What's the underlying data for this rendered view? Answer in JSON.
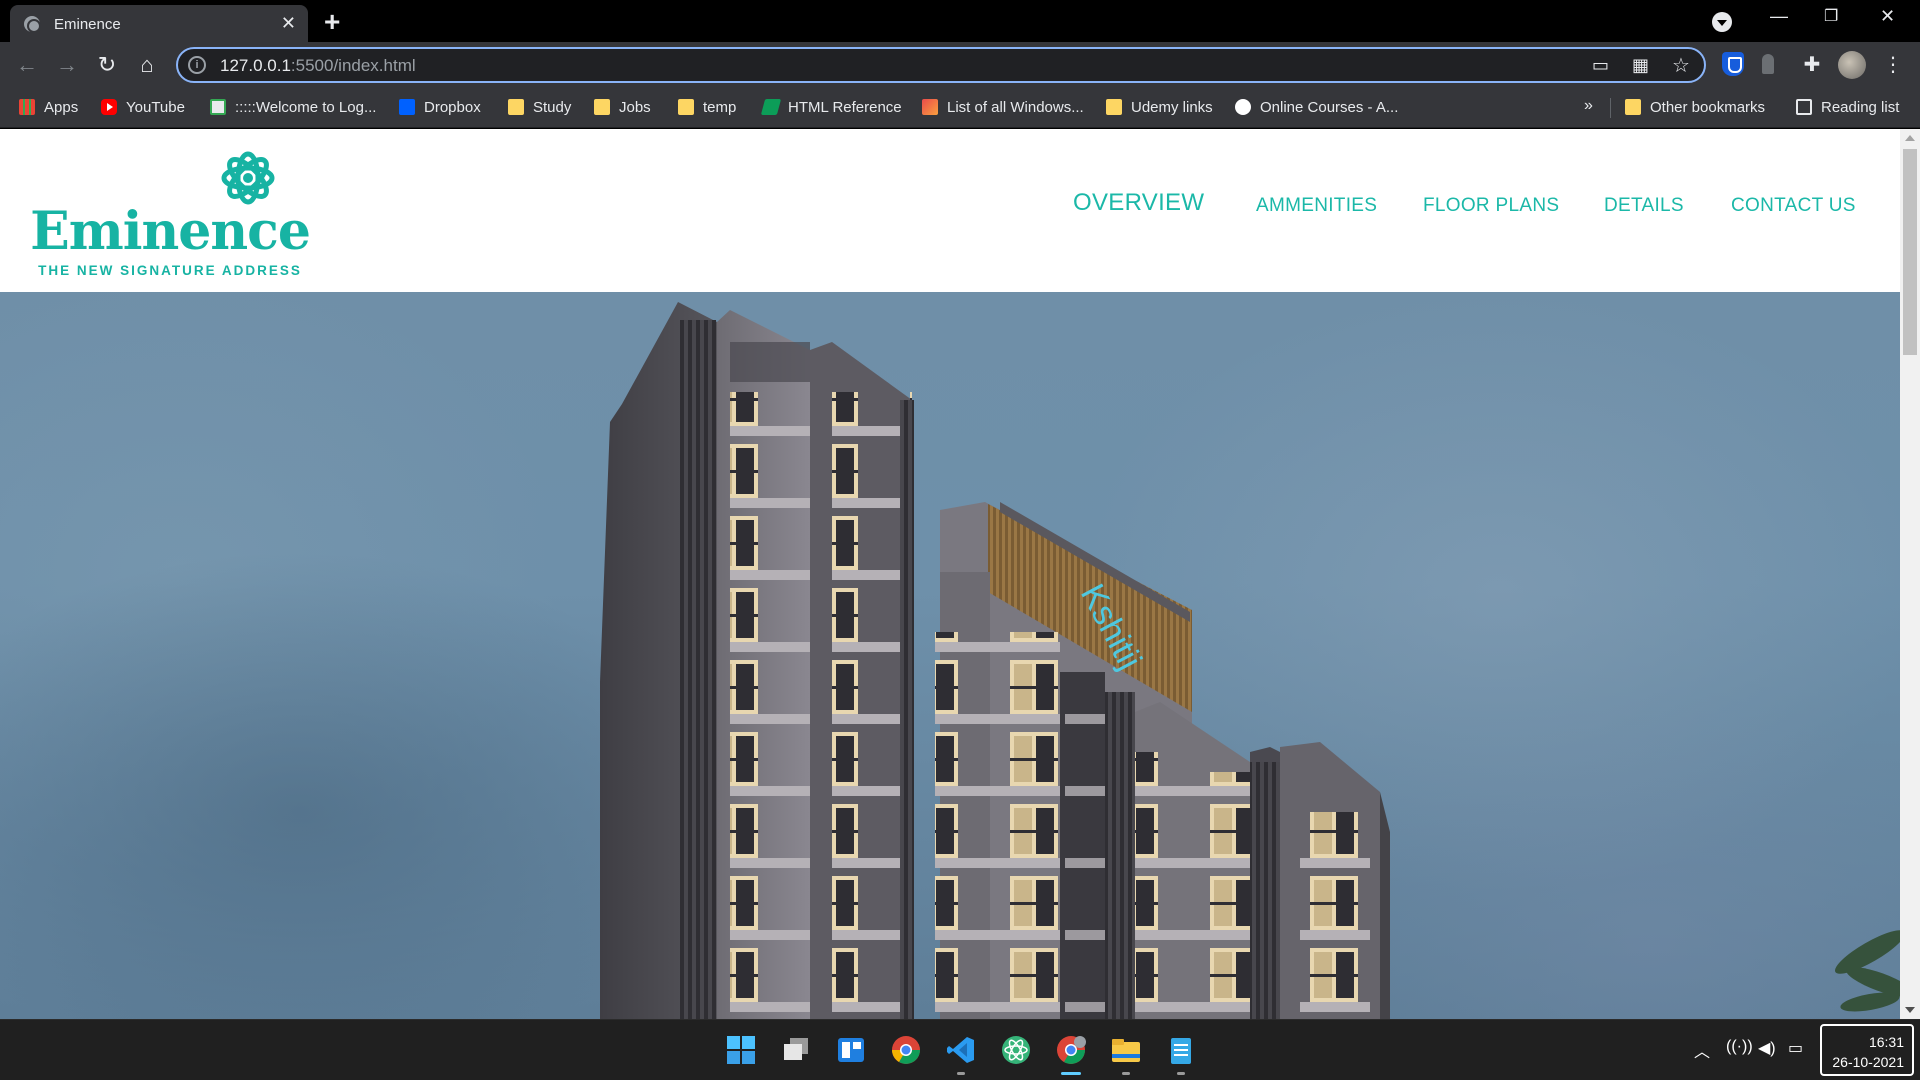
{
  "browser": {
    "tab_title": "Eminence",
    "url_host": "127.0.0.1",
    "url_path": ":5500/index.html"
  },
  "bookmarks": [
    {
      "label": "Apps",
      "icon": "apps-grid-icon"
    },
    {
      "label": "YouTube",
      "icon": "youtube-icon"
    },
    {
      "label": ":::::Welcome to Log...",
      "icon": "site-icon"
    },
    {
      "label": "Dropbox",
      "icon": "dropbox-icon"
    },
    {
      "label": "Study",
      "icon": "folder-icon"
    },
    {
      "label": "Jobs",
      "icon": "folder-icon"
    },
    {
      "label": "temp",
      "icon": "folder-icon"
    },
    {
      "label": "HTML Reference",
      "icon": "site-icon"
    },
    {
      "label": "List of all Windows...",
      "icon": "site-icon"
    },
    {
      "label": "Udemy links",
      "icon": "folder-icon"
    },
    {
      "label": "Online Courses - A...",
      "icon": "site-icon"
    }
  ],
  "bookmarks_right": {
    "overflow": "»",
    "other": "Other bookmarks",
    "reading_list": "Reading list"
  },
  "site": {
    "brand": "Eminence",
    "tagline": "THE NEW SIGNATURE ADDRESS",
    "accent_color": "#17b3a3",
    "nav": [
      "OVERVIEW",
      "AMMENITIES",
      "FLOOR PLANS",
      "DETAILS",
      "CONTACT US"
    ],
    "active_nav": "OVERVIEW",
    "building_sign": "Kshitij"
  },
  "taskbar": {
    "time": "16:31",
    "date": "26-10-2021"
  }
}
